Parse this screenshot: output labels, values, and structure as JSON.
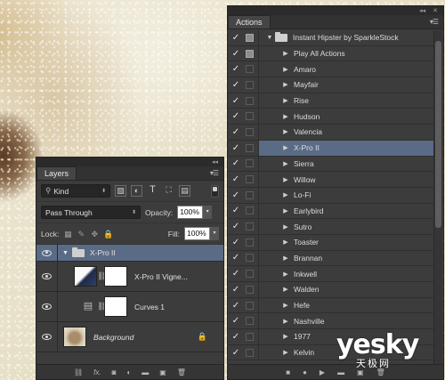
{
  "actions_panel": {
    "tab_label": "Actions",
    "rows": [
      {
        "label": "Instant Hipster by SparkleStock",
        "level": 0,
        "type": "set",
        "dialog": true,
        "selected": false
      },
      {
        "label": "Play All Actions",
        "level": 1,
        "type": "action",
        "dialog": true,
        "selected": false
      },
      {
        "label": "Amaro",
        "level": 1,
        "type": "action",
        "dialog": false,
        "selected": false
      },
      {
        "label": "Mayfair",
        "level": 1,
        "type": "action",
        "dialog": false,
        "selected": false
      },
      {
        "label": "Rise",
        "level": 1,
        "type": "action",
        "dialog": false,
        "selected": false
      },
      {
        "label": "Hudson",
        "level": 1,
        "type": "action",
        "dialog": false,
        "selected": false
      },
      {
        "label": "Valencia",
        "level": 1,
        "type": "action",
        "dialog": false,
        "selected": false
      },
      {
        "label": "X-Pro II",
        "level": 1,
        "type": "action",
        "dialog": false,
        "selected": true
      },
      {
        "label": "Sierra",
        "level": 1,
        "type": "action",
        "dialog": false,
        "selected": false
      },
      {
        "label": "Willow",
        "level": 1,
        "type": "action",
        "dialog": false,
        "selected": false
      },
      {
        "label": "Lo-Fi",
        "level": 1,
        "type": "action",
        "dialog": false,
        "selected": false
      },
      {
        "label": "Earlybird",
        "level": 1,
        "type": "action",
        "dialog": false,
        "selected": false
      },
      {
        "label": "Sutro",
        "level": 1,
        "type": "action",
        "dialog": false,
        "selected": false
      },
      {
        "label": "Toaster",
        "level": 1,
        "type": "action",
        "dialog": false,
        "selected": false
      },
      {
        "label": "Brannan",
        "level": 1,
        "type": "action",
        "dialog": false,
        "selected": false
      },
      {
        "label": "Inkwell",
        "level": 1,
        "type": "action",
        "dialog": false,
        "selected": false
      },
      {
        "label": "Walden",
        "level": 1,
        "type": "action",
        "dialog": false,
        "selected": false
      },
      {
        "label": "Hefe",
        "level": 1,
        "type": "action",
        "dialog": false,
        "selected": false
      },
      {
        "label": "Nashville",
        "level": 1,
        "type": "action",
        "dialog": false,
        "selected": false
      },
      {
        "label": "1977",
        "level": 1,
        "type": "action",
        "dialog": false,
        "selected": false
      },
      {
        "label": "Kelvin",
        "level": 1,
        "type": "action",
        "dialog": false,
        "selected": false
      }
    ],
    "check_glyph": "✓",
    "bottom_icons": [
      "stop-icon",
      "record-icon",
      "play-icon",
      "new-set-icon",
      "new-action-icon",
      "delete-icon"
    ]
  },
  "layers_panel": {
    "tab_label": "Layers",
    "filter_kind": "Kind",
    "blend_mode": "Pass Through",
    "opacity_label": "Opacity:",
    "opacity_value": "100%",
    "lock_label": "Lock:",
    "fill_label": "Fill:",
    "fill_value": "100%",
    "layers": [
      {
        "name": "X-Pro II",
        "kind": "group",
        "selected": true
      },
      {
        "name": "X-Pro II Vigne...",
        "kind": "adjustment",
        "selected": false
      },
      {
        "name": "Curves 1",
        "kind": "curves",
        "selected": false
      },
      {
        "name": "Background",
        "kind": "background",
        "locked": true,
        "selected": false
      }
    ],
    "bottom_icons": [
      "link-icon",
      "fx-icon",
      "add-mask-icon",
      "adjustment-icon",
      "new-group-icon",
      "new-layer-icon",
      "delete-icon"
    ]
  },
  "watermark": {
    "main": "yesky",
    "sub": "天极网"
  },
  "colors": {
    "panel_bg": "#3c3c3c",
    "selection": "#5a6b86",
    "photo_bg": "#e7e1cf"
  }
}
